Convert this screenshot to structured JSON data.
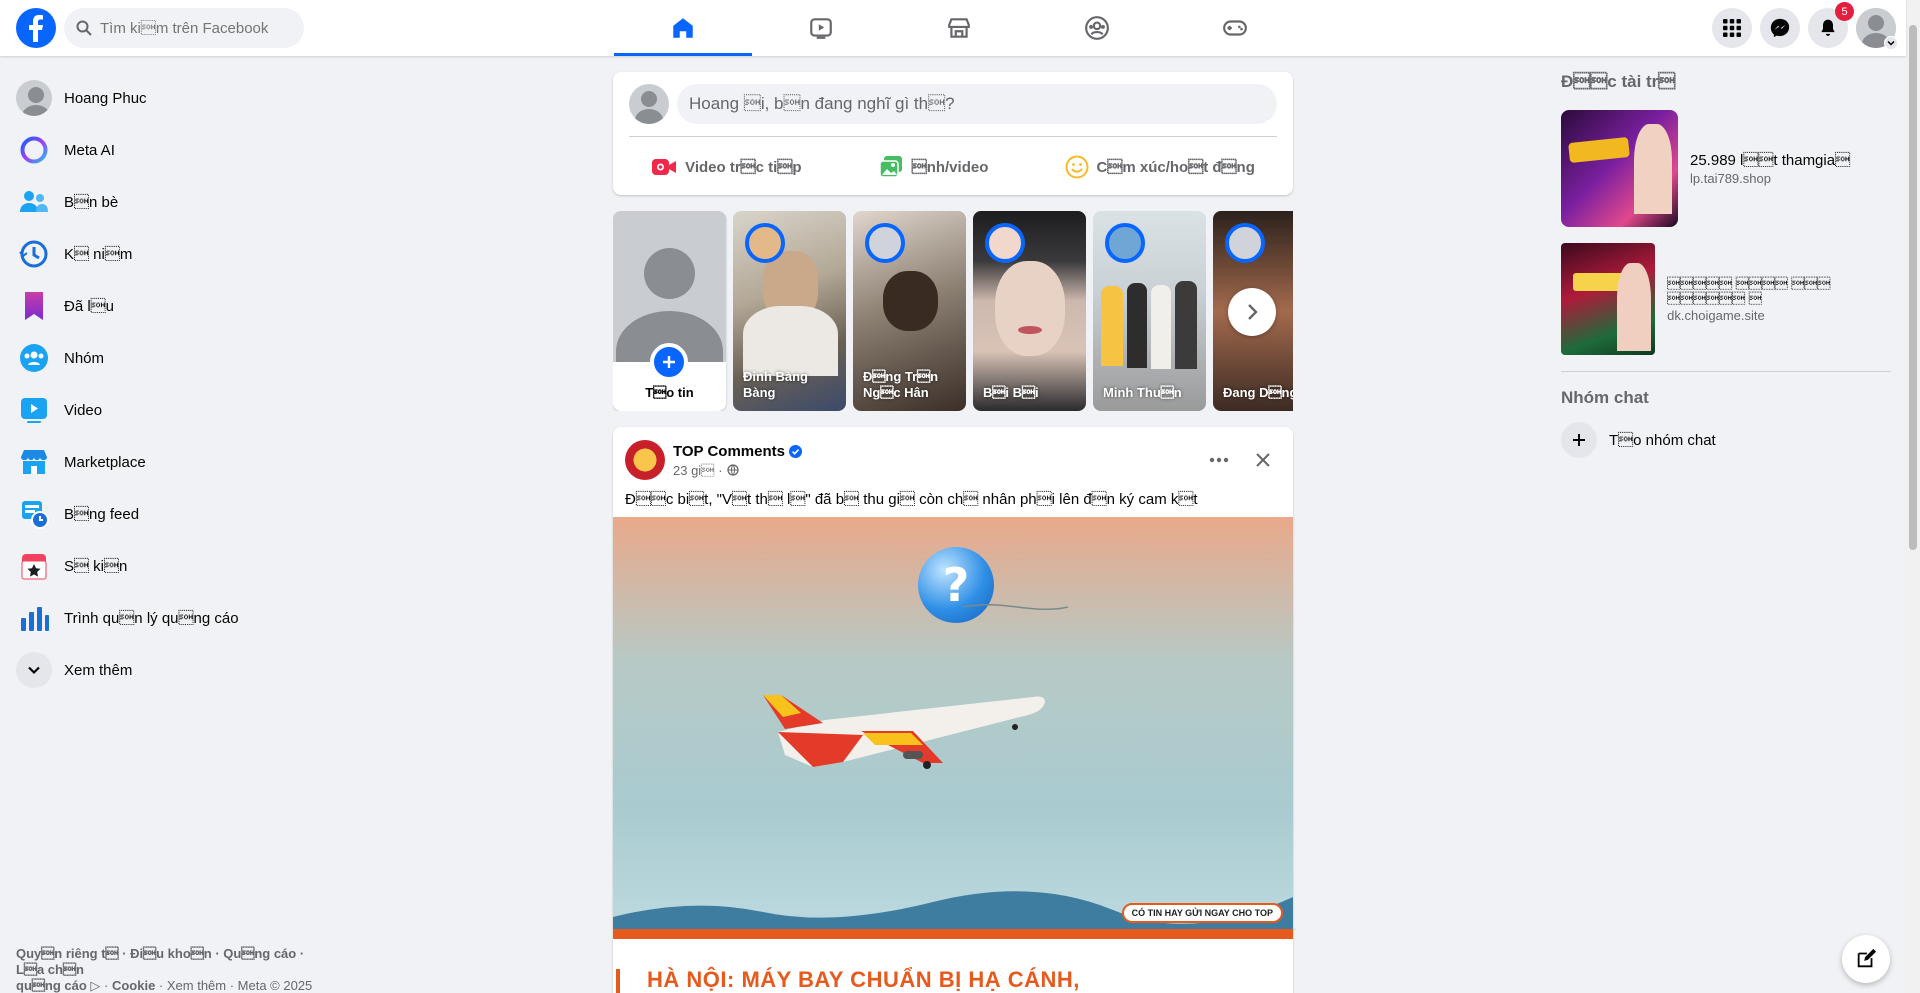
{
  "colors": {
    "accent": "#0866ff",
    "badge": "#e41e3f",
    "page_bg": "#f0f2f5"
  },
  "search": {
    "placeholder": "Tìm ki\u0001m trên Facebook"
  },
  "nav_tabs": [
    {
      "icon": "home-icon",
      "active": true
    },
    {
      "icon": "video-icon",
      "active": false
    },
    {
      "icon": "marketplace-icon",
      "active": false
    },
    {
      "icon": "groups-icon",
      "active": false
    },
    {
      "icon": "gaming-icon",
      "active": false
    }
  ],
  "header": {
    "notifications_count": "5"
  },
  "sidebar": {
    "items": [
      {
        "label": "Hoang Phuc",
        "icon": "profile-avatar"
      },
      {
        "label": "Meta AI",
        "icon": "meta-ai-icon"
      },
      {
        "label": "B\u0001n bè",
        "icon": "friends-icon"
      },
      {
        "label": "K\u0001 ni\u0001m",
        "icon": "memories-icon"
      },
      {
        "label": "Đã l\u0001u",
        "icon": "saved-icon"
      },
      {
        "label": "Nhóm",
        "icon": "groups-icon"
      },
      {
        "label": "Video",
        "icon": "video-icon"
      },
      {
        "label": "Marketplace",
        "icon": "marketplace-icon"
      },
      {
        "label": "B\u0001ng feed",
        "icon": "feeds-icon"
      },
      {
        "label": "S\u0001 ki\u0001n",
        "icon": "events-icon"
      },
      {
        "label": "Trình qu\u0001n lý qu\u0001ng cáo",
        "icon": "ads-manager-icon"
      },
      {
        "label": "Xem thêm",
        "icon": "chevron-down-icon"
      }
    ]
  },
  "footer": {
    "line1": "Quy\u0001n riêng t\u0001 · Đi\u0001u kho\u0001n · Qu\u0001ng cáo · L\u0001a ch\u0001n",
    "line2_a": "qu\u0001ng cáo ",
    "line2_b": "Cookie",
    "line2_c": "Xem thêm · Meta © 2025"
  },
  "composer": {
    "placeholder": "Hoang \u0001i, b\u0001n đang nghĩ gì th\u0001?",
    "actions": [
      {
        "label": "Video tr\u0001c ti\u0001p",
        "icon": "live-video-icon"
      },
      {
        "label": "\u0001nh/video",
        "icon": "photo-icon"
      },
      {
        "label": "C\u0001m xúc/ho\u0001t đ\u0001ng",
        "icon": "feeling-icon"
      }
    ]
  },
  "stories": {
    "create_label": "T\u0001o tin",
    "items": [
      {
        "name": "Đinh Bàng Bàng"
      },
      {
        "name": "Đ\u0001ng Tr\u0001n Ng\u0001c Hân"
      },
      {
        "name": "B\u0001i B\u0001i"
      },
      {
        "name": "Minh Thu\u0001n"
      },
      {
        "name": "Đang D\u0001ng"
      }
    ]
  },
  "post": {
    "author": "TOP Comments",
    "time": "23 gi\u0001",
    "text": "Đ\u0001\u0001c bi\u0001t, \"V\u0001t th\u0001 l\u0001\" đã b\u0001 thu gi\u0001 còn ch\u0001 nhân ph\u0001i lên đ\u0001n ký cam k\u0001t",
    "image_banner": "HÀ NỘI: MÁY BAY CHUẨN BỊ HẠ CÁNH,",
    "image_stamp": "CÓ TIN HAY GỬI NGAY CHO TOP"
  },
  "right": {
    "sponsored_title": "Đ\u0001\u0001c tài tr\u0001",
    "ads": [
      {
        "title": "25.989 l\u0001\u0001t thamgia\u0001",
        "url": "lp.tai789.shop"
      },
      {
        "title": "\u0001\u0001\u0001\u0001\u0001 \u0001\u0001\u0001\u0001 \u0001\u0001\u0001 \u0001\u0001\u0001\u0001\u0001\u0001 \u0001",
        "url": "dk.choigame.site"
      }
    ],
    "group_chat_title": "Nhóm chat",
    "create_group": "T\u0001o nhóm chat"
  }
}
